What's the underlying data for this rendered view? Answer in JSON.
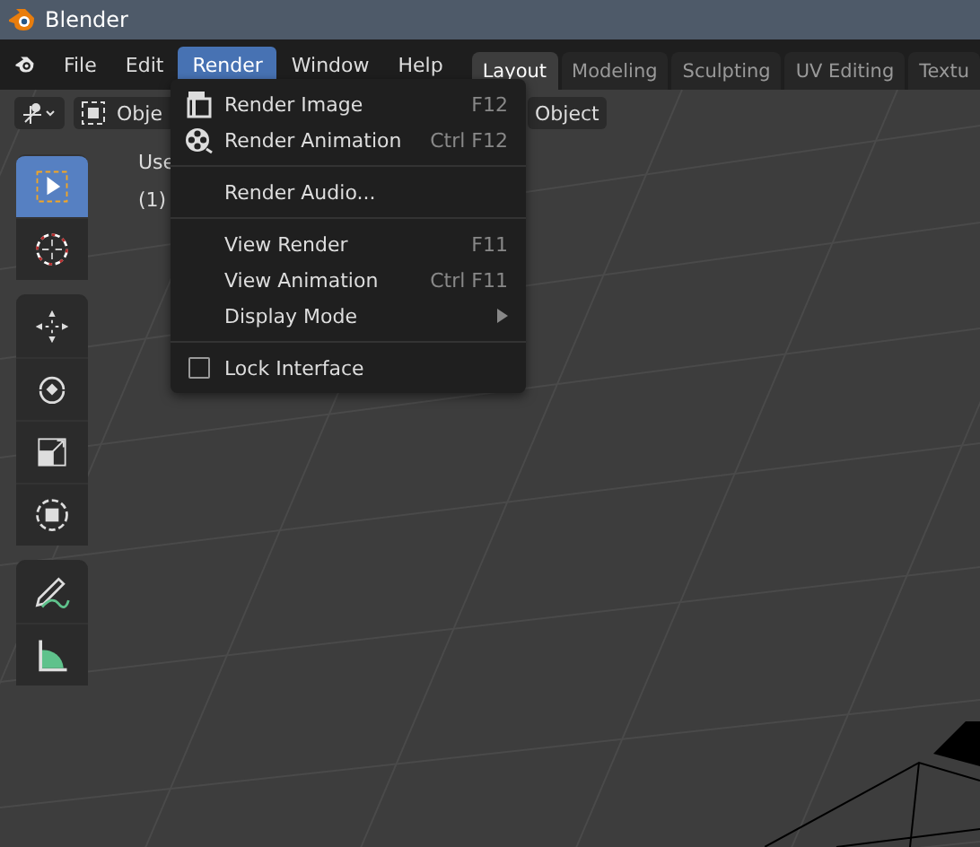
{
  "window": {
    "title": "Blender"
  },
  "menubar": [
    {
      "label": "File",
      "selected": false
    },
    {
      "label": "Edit",
      "selected": false
    },
    {
      "label": "Render",
      "selected": true
    },
    {
      "label": "Window",
      "selected": false
    },
    {
      "label": "Help",
      "selected": false
    }
  ],
  "workspace_tabs": [
    {
      "label": "Layout",
      "selected": true
    },
    {
      "label": "Modeling",
      "selected": false
    },
    {
      "label": "Sculpting",
      "selected": false
    },
    {
      "label": "UV Editing",
      "selected": false
    },
    {
      "label": "Textu",
      "selected": false
    }
  ],
  "viewport_header": {
    "mode": "Obje",
    "menu_item": "Object"
  },
  "viewport_overlay": {
    "view_name": "Use",
    "collection": "(1)"
  },
  "toolbar": [
    {
      "kind": "select",
      "selected": true,
      "group_start": false
    },
    {
      "kind": "cursor",
      "selected": false,
      "group_start": false
    },
    {
      "kind": "move",
      "selected": false,
      "group_start": true
    },
    {
      "kind": "rotate",
      "selected": false,
      "group_start": false
    },
    {
      "kind": "scale",
      "selected": false,
      "group_start": false
    },
    {
      "kind": "transform",
      "selected": false,
      "group_start": false
    },
    {
      "kind": "annotate",
      "selected": false,
      "group_start": true
    },
    {
      "kind": "measure",
      "selected": false,
      "group_start": false
    }
  ],
  "render_menu": [
    {
      "kind": "render-image",
      "label": "Render Image",
      "shortcut": "F12"
    },
    {
      "kind": "render-animation",
      "label": "Render Animation",
      "shortcut": "Ctrl F12"
    },
    {
      "kind": "separator"
    },
    {
      "kind": "plain",
      "label": "Render Audio..."
    },
    {
      "kind": "separator"
    },
    {
      "kind": "plain",
      "label": "View Render",
      "shortcut": "F11"
    },
    {
      "kind": "plain",
      "label": "View Animation",
      "shortcut": "Ctrl F11"
    },
    {
      "kind": "submenu",
      "label": "Display Mode"
    },
    {
      "kind": "separator"
    },
    {
      "kind": "checkbox",
      "label": "Lock Interface",
      "checked": false
    }
  ]
}
